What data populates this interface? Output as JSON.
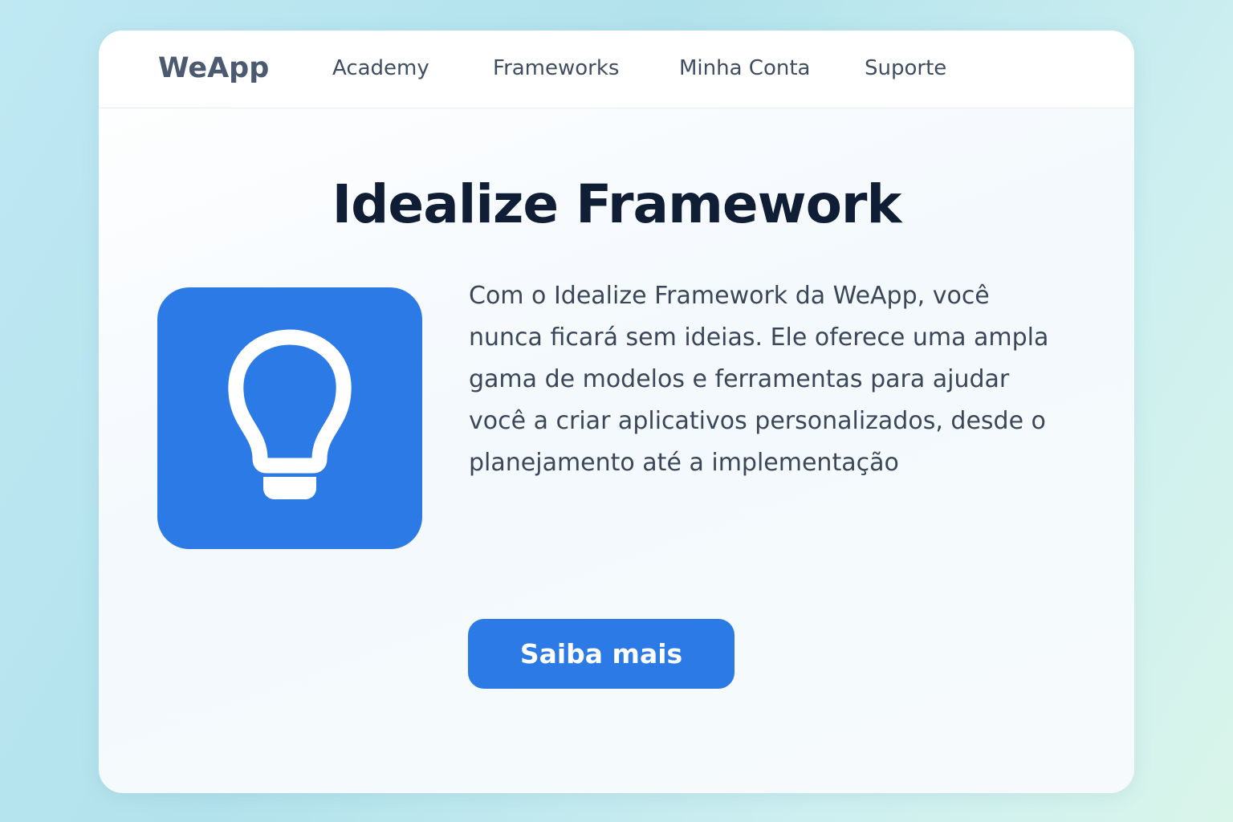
{
  "header": {
    "brand": "WeApp",
    "nav": [
      {
        "label": "Academy"
      },
      {
        "label": "Frameworks"
      },
      {
        "label": "Minha Conta"
      },
      {
        "label": "Suporte"
      }
    ]
  },
  "main": {
    "title": "Idealize Framework",
    "icon": "lightbulb-icon",
    "description": "Com o Idealize Framework da WeApp, você nunca ficará sem ideias. Ele oferece uma ampla gama de modelos e ferramentas para ajudar você a criar aplicativos personalizados, desde o planejamento até a implementação",
    "cta_label": "Saiba mais"
  },
  "colors": {
    "accent": "#2c7ae6",
    "title": "#0f1d35",
    "text": "#3b4759",
    "brand": "#4b5a6e"
  }
}
